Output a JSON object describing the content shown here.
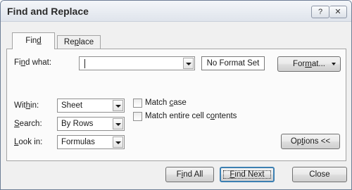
{
  "window": {
    "title": "Find and Replace",
    "help_glyph": "?",
    "close_glyph": "✕"
  },
  "tabs": {
    "find": {
      "pre": "Fin",
      "mn": "d",
      "post": ""
    },
    "replace": {
      "pre": "Re",
      "mn": "p",
      "post": "lace"
    }
  },
  "find_what": {
    "label": {
      "pre": "Fi",
      "mn": "n",
      "post": "d what:"
    },
    "value": "",
    "format_status": "No Format Set",
    "format_button": {
      "pre": "For",
      "mn": "m",
      "post": "at..."
    }
  },
  "within": {
    "label": {
      "pre": "Wit",
      "mn": "h",
      "post": "in:"
    },
    "value": "Sheet"
  },
  "search": {
    "label": {
      "pre": "",
      "mn": "S",
      "post": "earch:"
    },
    "value": "By Rows"
  },
  "look_in": {
    "label": {
      "pre": "",
      "mn": "L",
      "post": "ook in:"
    },
    "value": "Formulas"
  },
  "options": {
    "match_case": {
      "pre": "Match ",
      "mn": "c",
      "post": "ase",
      "checked": false
    },
    "match_entire": {
      "pre": "Match entire cell c",
      "mn": "o",
      "post": "ntents",
      "checked": false
    },
    "options_button": {
      "pre": "Op",
      "mn": "t",
      "post": "ions <<"
    }
  },
  "buttons": {
    "find_all": {
      "pre": "F",
      "mn": "i",
      "post": "nd All"
    },
    "find_next": {
      "pre": "",
      "mn": "F",
      "post": "ind Next"
    },
    "close": "Close"
  }
}
